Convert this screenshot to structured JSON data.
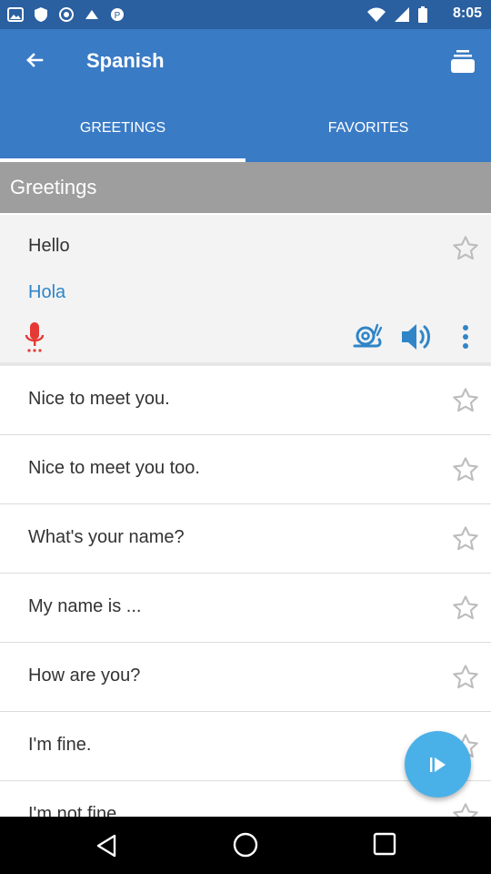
{
  "status_bar": {
    "time": "8:05"
  },
  "app_bar": {
    "title": "Spanish"
  },
  "tabs": [
    {
      "label": "GREETINGS",
      "active": true
    },
    {
      "label": "FAVORITES",
      "active": false
    }
  ],
  "section": {
    "title": "Greetings"
  },
  "expanded_item": {
    "phrase": "Hello",
    "translation": "Hola"
  },
  "items": [
    {
      "phrase": "Nice to meet you."
    },
    {
      "phrase": "Nice to meet you too."
    },
    {
      "phrase": "What's your name?"
    },
    {
      "phrase": "My name is ..."
    },
    {
      "phrase": "How are you?"
    },
    {
      "phrase": "I'm fine."
    },
    {
      "phrase": "I'm not fine."
    }
  ],
  "colors": {
    "status_bar": "#2a5fa0",
    "app_bar": "#3a7bc5",
    "section_header": "#9e9e9e",
    "translation": "#2f85c8",
    "mic": "#e53935",
    "fab": "#4ab0e8"
  },
  "icons": {
    "back": "arrow-left-icon",
    "cards": "card-stack-icon",
    "star": "star-outline-icon",
    "mic": "microphone-icon",
    "snail": "snail-icon",
    "speaker": "speaker-icon",
    "more": "more-vertical-icon",
    "play": "play-icon"
  }
}
